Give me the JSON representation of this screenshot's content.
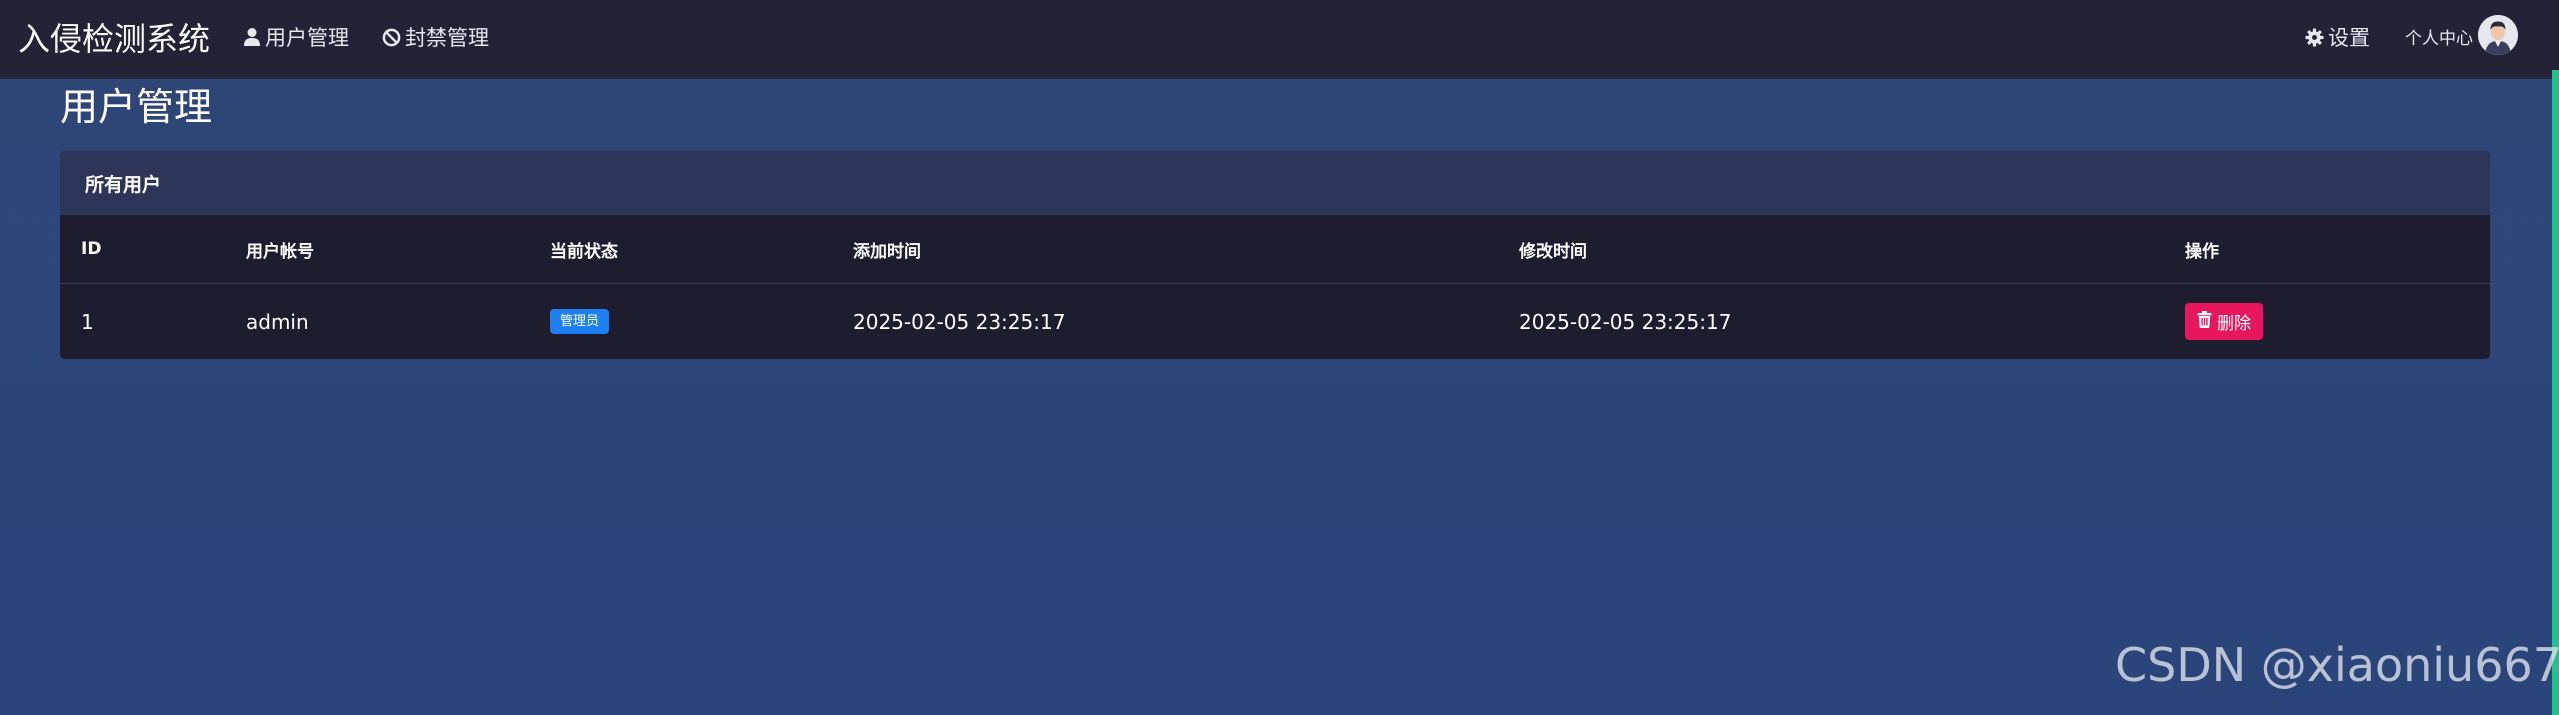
{
  "navbar": {
    "brand": "入侵检测系统",
    "links": [
      {
        "label": "用户管理",
        "icon": "user-icon"
      },
      {
        "label": "封禁管理",
        "icon": "ban-icon"
      }
    ],
    "settings_label": "设置",
    "profile_label": "个人中心"
  },
  "page": {
    "title": "用户管理"
  },
  "users_card": {
    "title": "所有用户",
    "columns": [
      "ID",
      "用户帐号",
      "当前状态",
      "添加时间",
      "修改时间",
      "操作"
    ],
    "rows": [
      {
        "id": "1",
        "account": "admin",
        "status": "管理员",
        "created": "2025-02-05 23:25:17",
        "modified": "2025-02-05 23:25:17",
        "action": "删除"
      }
    ]
  },
  "colors": {
    "navbar_bg": "#232337",
    "page_bg": "#2d4578",
    "card_header_bg": "#2c3557",
    "table_bg": "#1e1d2f",
    "badge_blue": "#1e7ff0",
    "delete_red": "#e8175d",
    "scroll_accent": "#1ec48a"
  },
  "watermark": "CSDN @xiaoniu667"
}
